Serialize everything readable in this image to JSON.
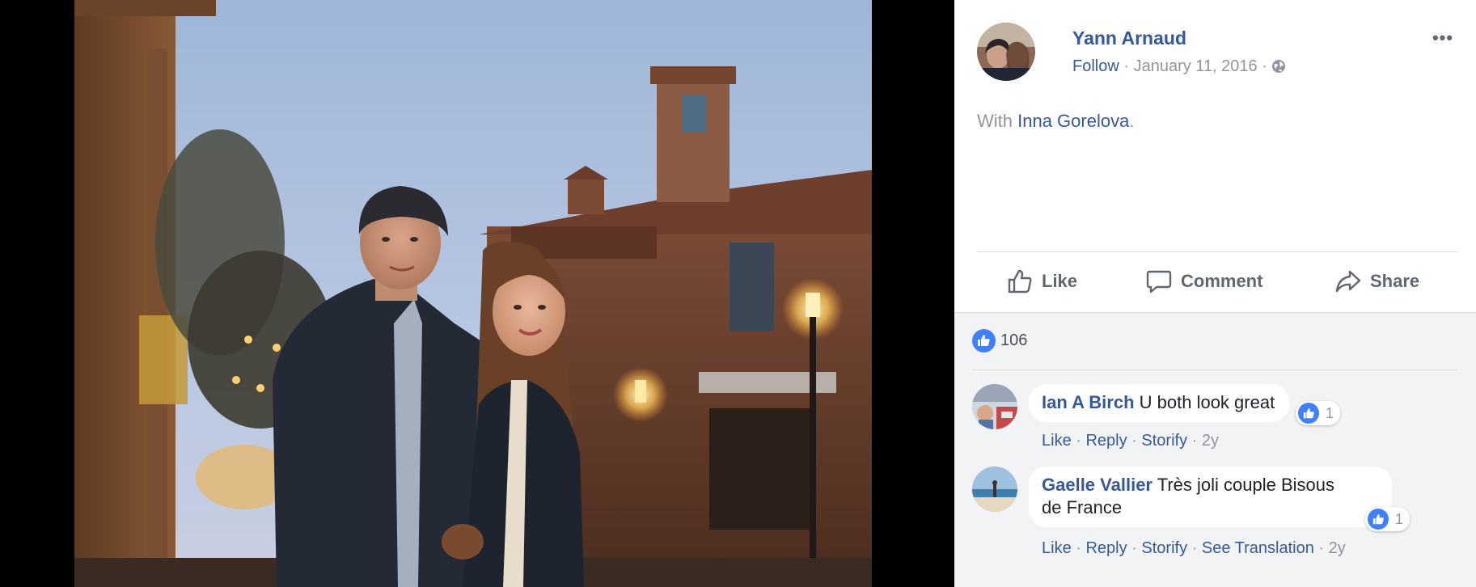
{
  "post": {
    "author": "Yann Arnaud",
    "follow_label": "Follow",
    "date": "January 11, 2016",
    "dot": "·",
    "more_label": "•••",
    "with_prefix": "With ",
    "tagged_person": "Inna Gorelova",
    "with_suffix": ".",
    "privacy_icon": "globe-icon"
  },
  "actions": {
    "like_label": "Like",
    "comment_label": "Comment",
    "share_label": "Share"
  },
  "reactions": {
    "count": "106",
    "icon": "like-icon"
  },
  "comments": [
    {
      "name": "Ian A Birch",
      "text": "U both look great",
      "likes": "1",
      "links": [
        "Like",
        "Reply",
        "Storify"
      ],
      "age": "2y"
    },
    {
      "name": "Gaelle Vallier",
      "text_line1": "Très joli couple Bisous",
      "text_line2": "de France",
      "likes": "1",
      "links": [
        "Like",
        "Reply",
        "Storify",
        "See Translation"
      ],
      "age": "2y"
    }
  ],
  "colors": {
    "link": "#365899",
    "muted": "#90949c",
    "like_blue": "#4080ff",
    "comment_bg": "#f2f3f5"
  }
}
